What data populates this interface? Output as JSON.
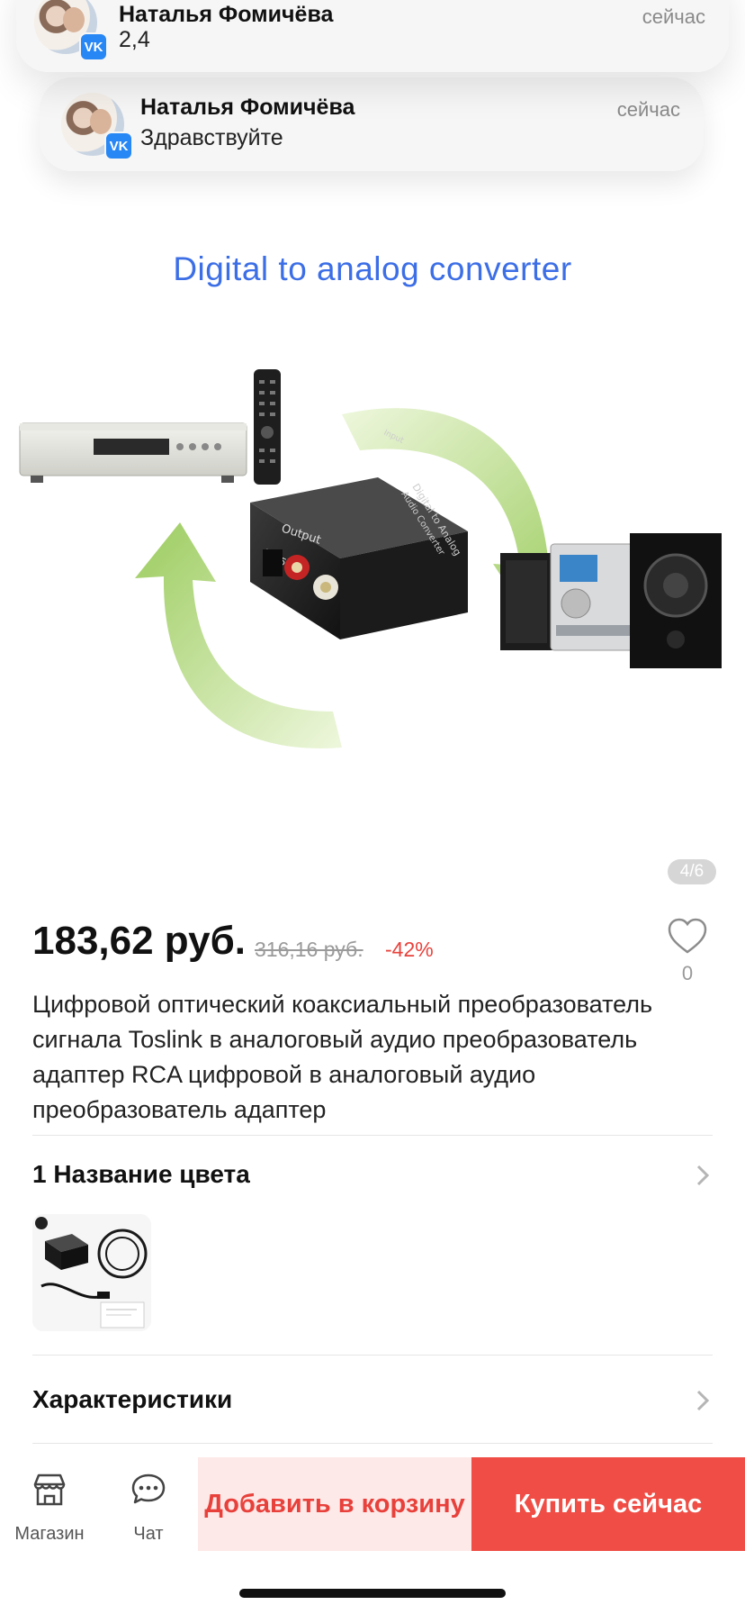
{
  "notifications": [
    {
      "sender": "Наталья Фомичёва",
      "message": "2,4",
      "time": "сейчас"
    },
    {
      "sender": "Наталья Фомичёва",
      "message": "Здравствуйте",
      "time": "сейчас"
    }
  ],
  "notification_icon": "vk-icon",
  "gallery": {
    "image_title": "Digital to analog converter",
    "device_labels": {
      "output": "Output",
      "dc": "DC/5",
      "converter_line1": "Digital to Analog",
      "converter_line2": "Audio Converter",
      "input": "Input"
    },
    "counter": "4/6"
  },
  "product": {
    "price": "183,62 руб.",
    "old_price": "316,16 руб.",
    "discount": "-42%",
    "favorites_count": "0",
    "title": "Цифровой оптический коаксиальный преобразователь сигнала Toslink в аналоговый аудио преобразователь адаптер RCA цифровой в аналоговый аудио преобразователь адаптер"
  },
  "sections": {
    "color": "1 Название цвета",
    "specs": "Характеристики"
  },
  "bottom_bar": {
    "shop_label": "Магазин",
    "chat_label": "Чат",
    "add_to_cart": "Добавить в корзину",
    "buy_now": "Купить сейчас"
  },
  "colors": {
    "accent": "#ef4d45",
    "accent_light": "#fde9e8",
    "vk_blue": "#2787f5",
    "hero_title": "#3c6ee6",
    "arrow_green": "#a6d36b"
  }
}
